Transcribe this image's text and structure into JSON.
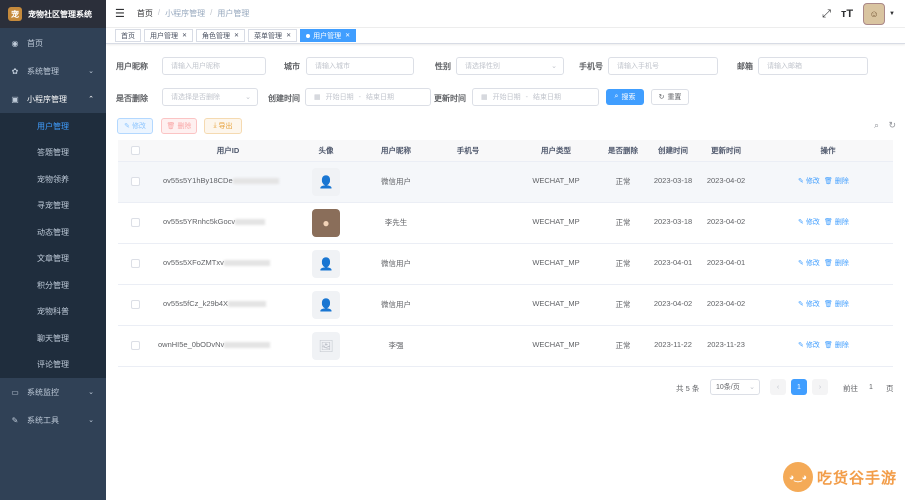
{
  "app": {
    "title": "宠物社区管理系统",
    "logo_text": "宠"
  },
  "sidebar": {
    "items": [
      {
        "label": "首页",
        "icon": "dashboard-icon"
      },
      {
        "label": "系统管理",
        "icon": "gear-icon"
      },
      {
        "label": "小程序管理",
        "icon": "grid-icon"
      },
      {
        "label": "系统监控",
        "icon": "monitor-icon"
      },
      {
        "label": "系统工具",
        "icon": "tool-icon"
      }
    ],
    "sub_items": [
      "用户管理",
      "答题管理",
      "宠物领养",
      "寻宠管理",
      "动态管理",
      "文章管理",
      "积分管理",
      "宠物科普",
      "聊天管理",
      "评论管理"
    ]
  },
  "navbar": {
    "breadcrumb": [
      "首页",
      "小程序管理",
      "用户管理"
    ],
    "sep": "/",
    "avatar_glyph": "☺"
  },
  "tags": [
    {
      "label": "首页"
    },
    {
      "label": "用户管理"
    },
    {
      "label": "角色管理"
    },
    {
      "label": "菜单管理"
    },
    {
      "label": "用户管理"
    }
  ],
  "search": {
    "nickname_label": "用户昵称",
    "nickname_ph": "请输入用户昵称",
    "city_label": "城市",
    "city_ph": "请输入城市",
    "gender_label": "性别",
    "gender_ph": "请选择性别",
    "phone_label": "手机号",
    "phone_ph": "请输入手机号",
    "email_label": "邮箱",
    "email_ph": "请输入邮箱",
    "deleted_label": "是否删除",
    "deleted_ph": "请选择是否删除",
    "created_label": "创建时间",
    "updated_label": "更新时间",
    "start_ph": "开始日期",
    "end_ph": "结束日期",
    "range_sep": "-",
    "search_btn": "搜索",
    "reset_btn": "重置"
  },
  "toolbar": {
    "edit": "修改",
    "delete": "删除",
    "export": "导出"
  },
  "table": {
    "headers": [
      "用户ID",
      "头像",
      "用户昵称",
      "手机号",
      "用户类型",
      "是否删除",
      "创建时间",
      "更新时间",
      "操作"
    ],
    "edit_label": "修改",
    "delete_label": "删除",
    "rows": [
      {
        "id": "ov55s5Y1hBy18CDe",
        "nickname": "微信用户",
        "phone": "",
        "type": "WECHAT_MP",
        "deleted": "正常",
        "created": "2023-03-18",
        "updated": "2023-04-02"
      },
      {
        "id": "ov55s5YRnhc5kGocv",
        "nickname": "李先生",
        "phone": "",
        "type": "WECHAT_MP",
        "deleted": "正常",
        "created": "2023-03-18",
        "updated": "2023-04-02"
      },
      {
        "id": "ov55s5XFoZMTxv",
        "nickname": "微信用户",
        "phone": "",
        "type": "WECHAT_MP",
        "deleted": "正常",
        "created": "2023-04-01",
        "updated": "2023-04-01"
      },
      {
        "id": "ov55s5fCz_k29b4X",
        "nickname": "微信用户",
        "phone": "",
        "type": "WECHAT_MP",
        "deleted": "正常",
        "created": "2023-04-02",
        "updated": "2023-04-02"
      },
      {
        "id": "ownHI5e_0bODvNv",
        "nickname": "李强",
        "phone": "",
        "type": "WECHAT_MP",
        "deleted": "正常",
        "created": "2023-11-22",
        "updated": "2023-11-23"
      }
    ]
  },
  "pagination": {
    "total": "共 5 条",
    "page_size": "10条/页",
    "current": "1",
    "goto_label": "前往",
    "goto_value": "1",
    "page_unit": "页"
  },
  "watermark": {
    "text": "吃货谷手游"
  }
}
